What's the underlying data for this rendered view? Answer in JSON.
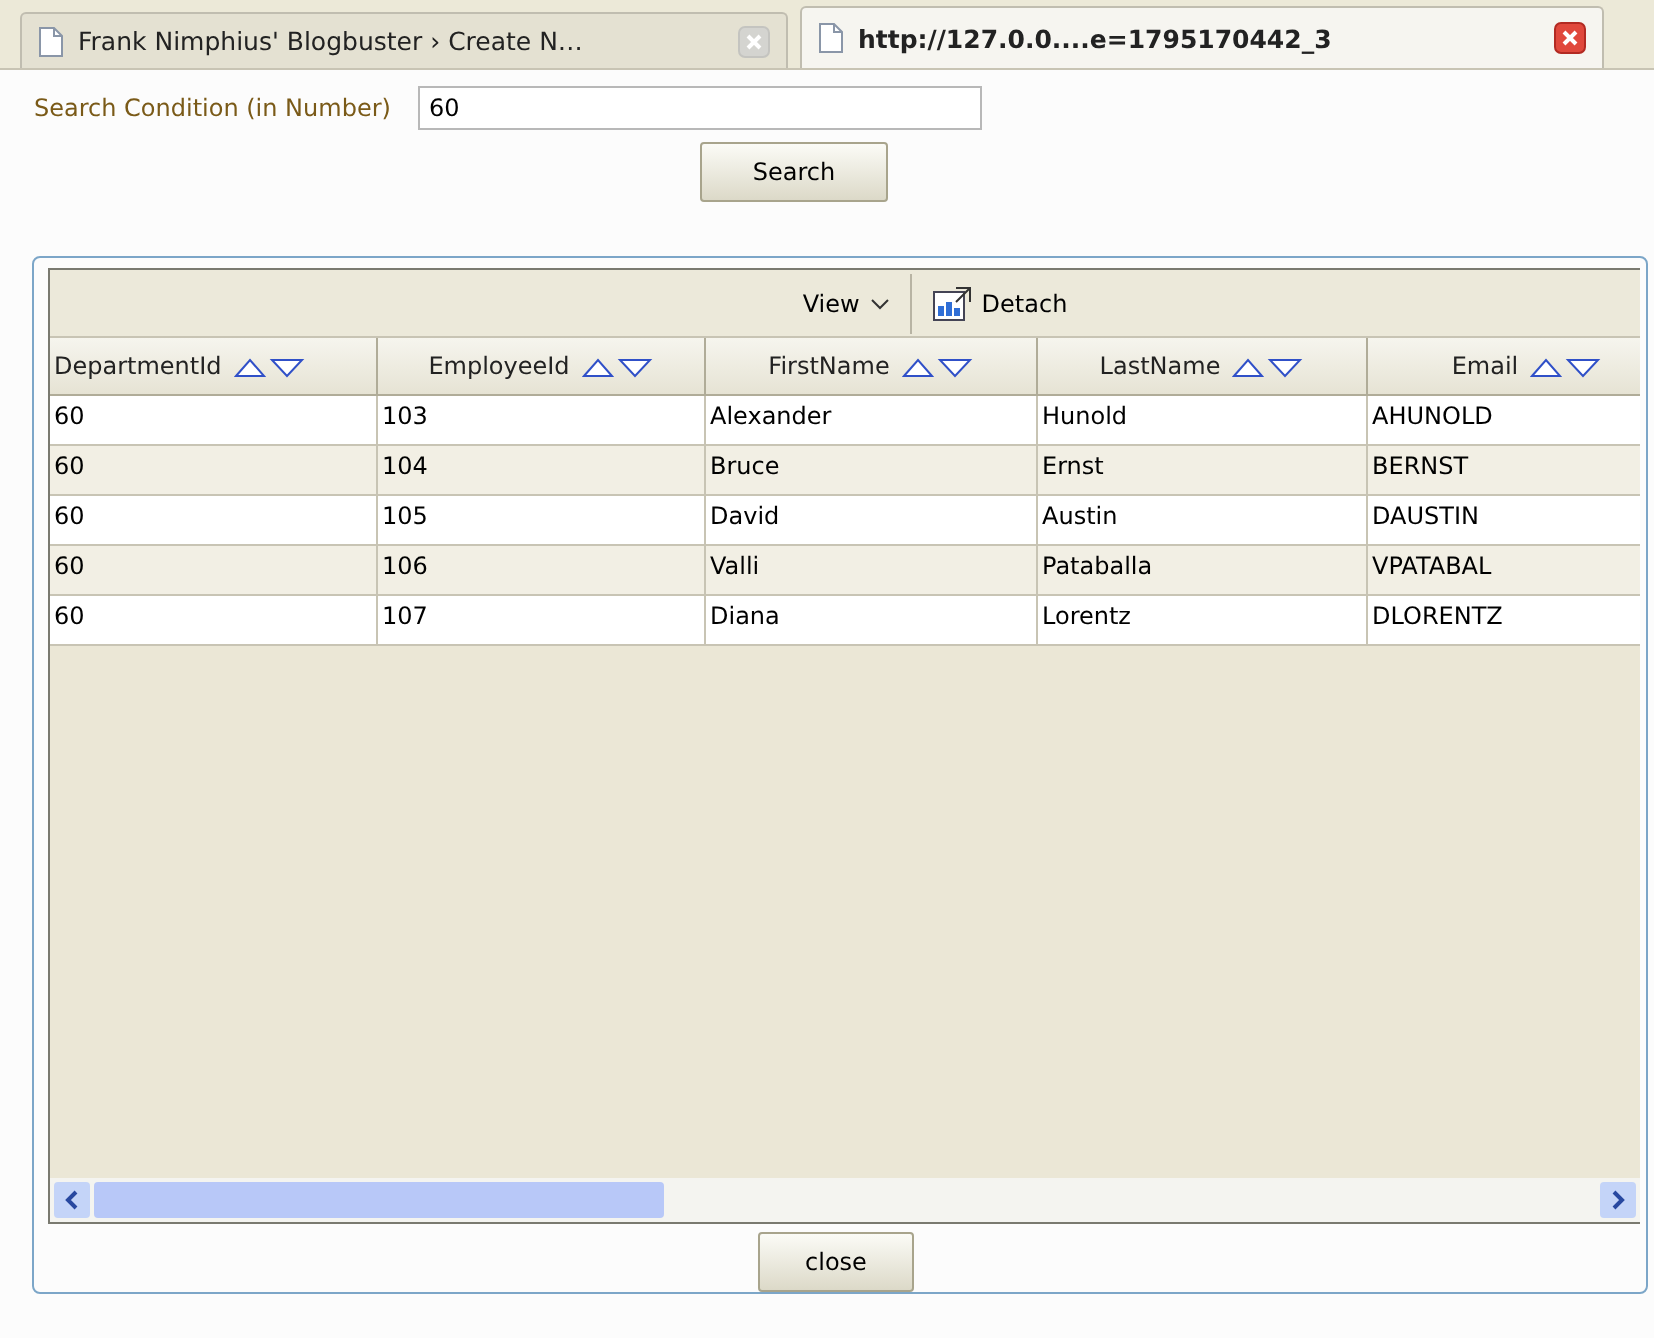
{
  "tabs": [
    {
      "label": "Frank Nimphius' Blogbuster › Create N…",
      "selected": false
    },
    {
      "label": "http://127.0.0....e=1795170442_3",
      "selected": true
    }
  ],
  "search": {
    "label": "Search Condition (in Number)",
    "value": "60",
    "button": "Search"
  },
  "table": {
    "toolbar": {
      "view": "View",
      "detach": "Detach"
    },
    "columns": [
      "DepartmentId",
      "EmployeeId",
      "FirstName",
      "LastName",
      "Email"
    ],
    "rows": [
      [
        "60",
        "103",
        "Alexander",
        "Hunold",
        "AHUNOLD"
      ],
      [
        "60",
        "104",
        "Bruce",
        "Ernst",
        "BERNST"
      ],
      [
        "60",
        "105",
        "David",
        "Austin",
        "DAUSTIN"
      ],
      [
        "60",
        "106",
        "Valli",
        "Pataballa",
        "VPATABAL"
      ],
      [
        "60",
        "107",
        "Diana",
        "Lorentz",
        "DLORENTZ"
      ]
    ]
  },
  "close_button": "close"
}
